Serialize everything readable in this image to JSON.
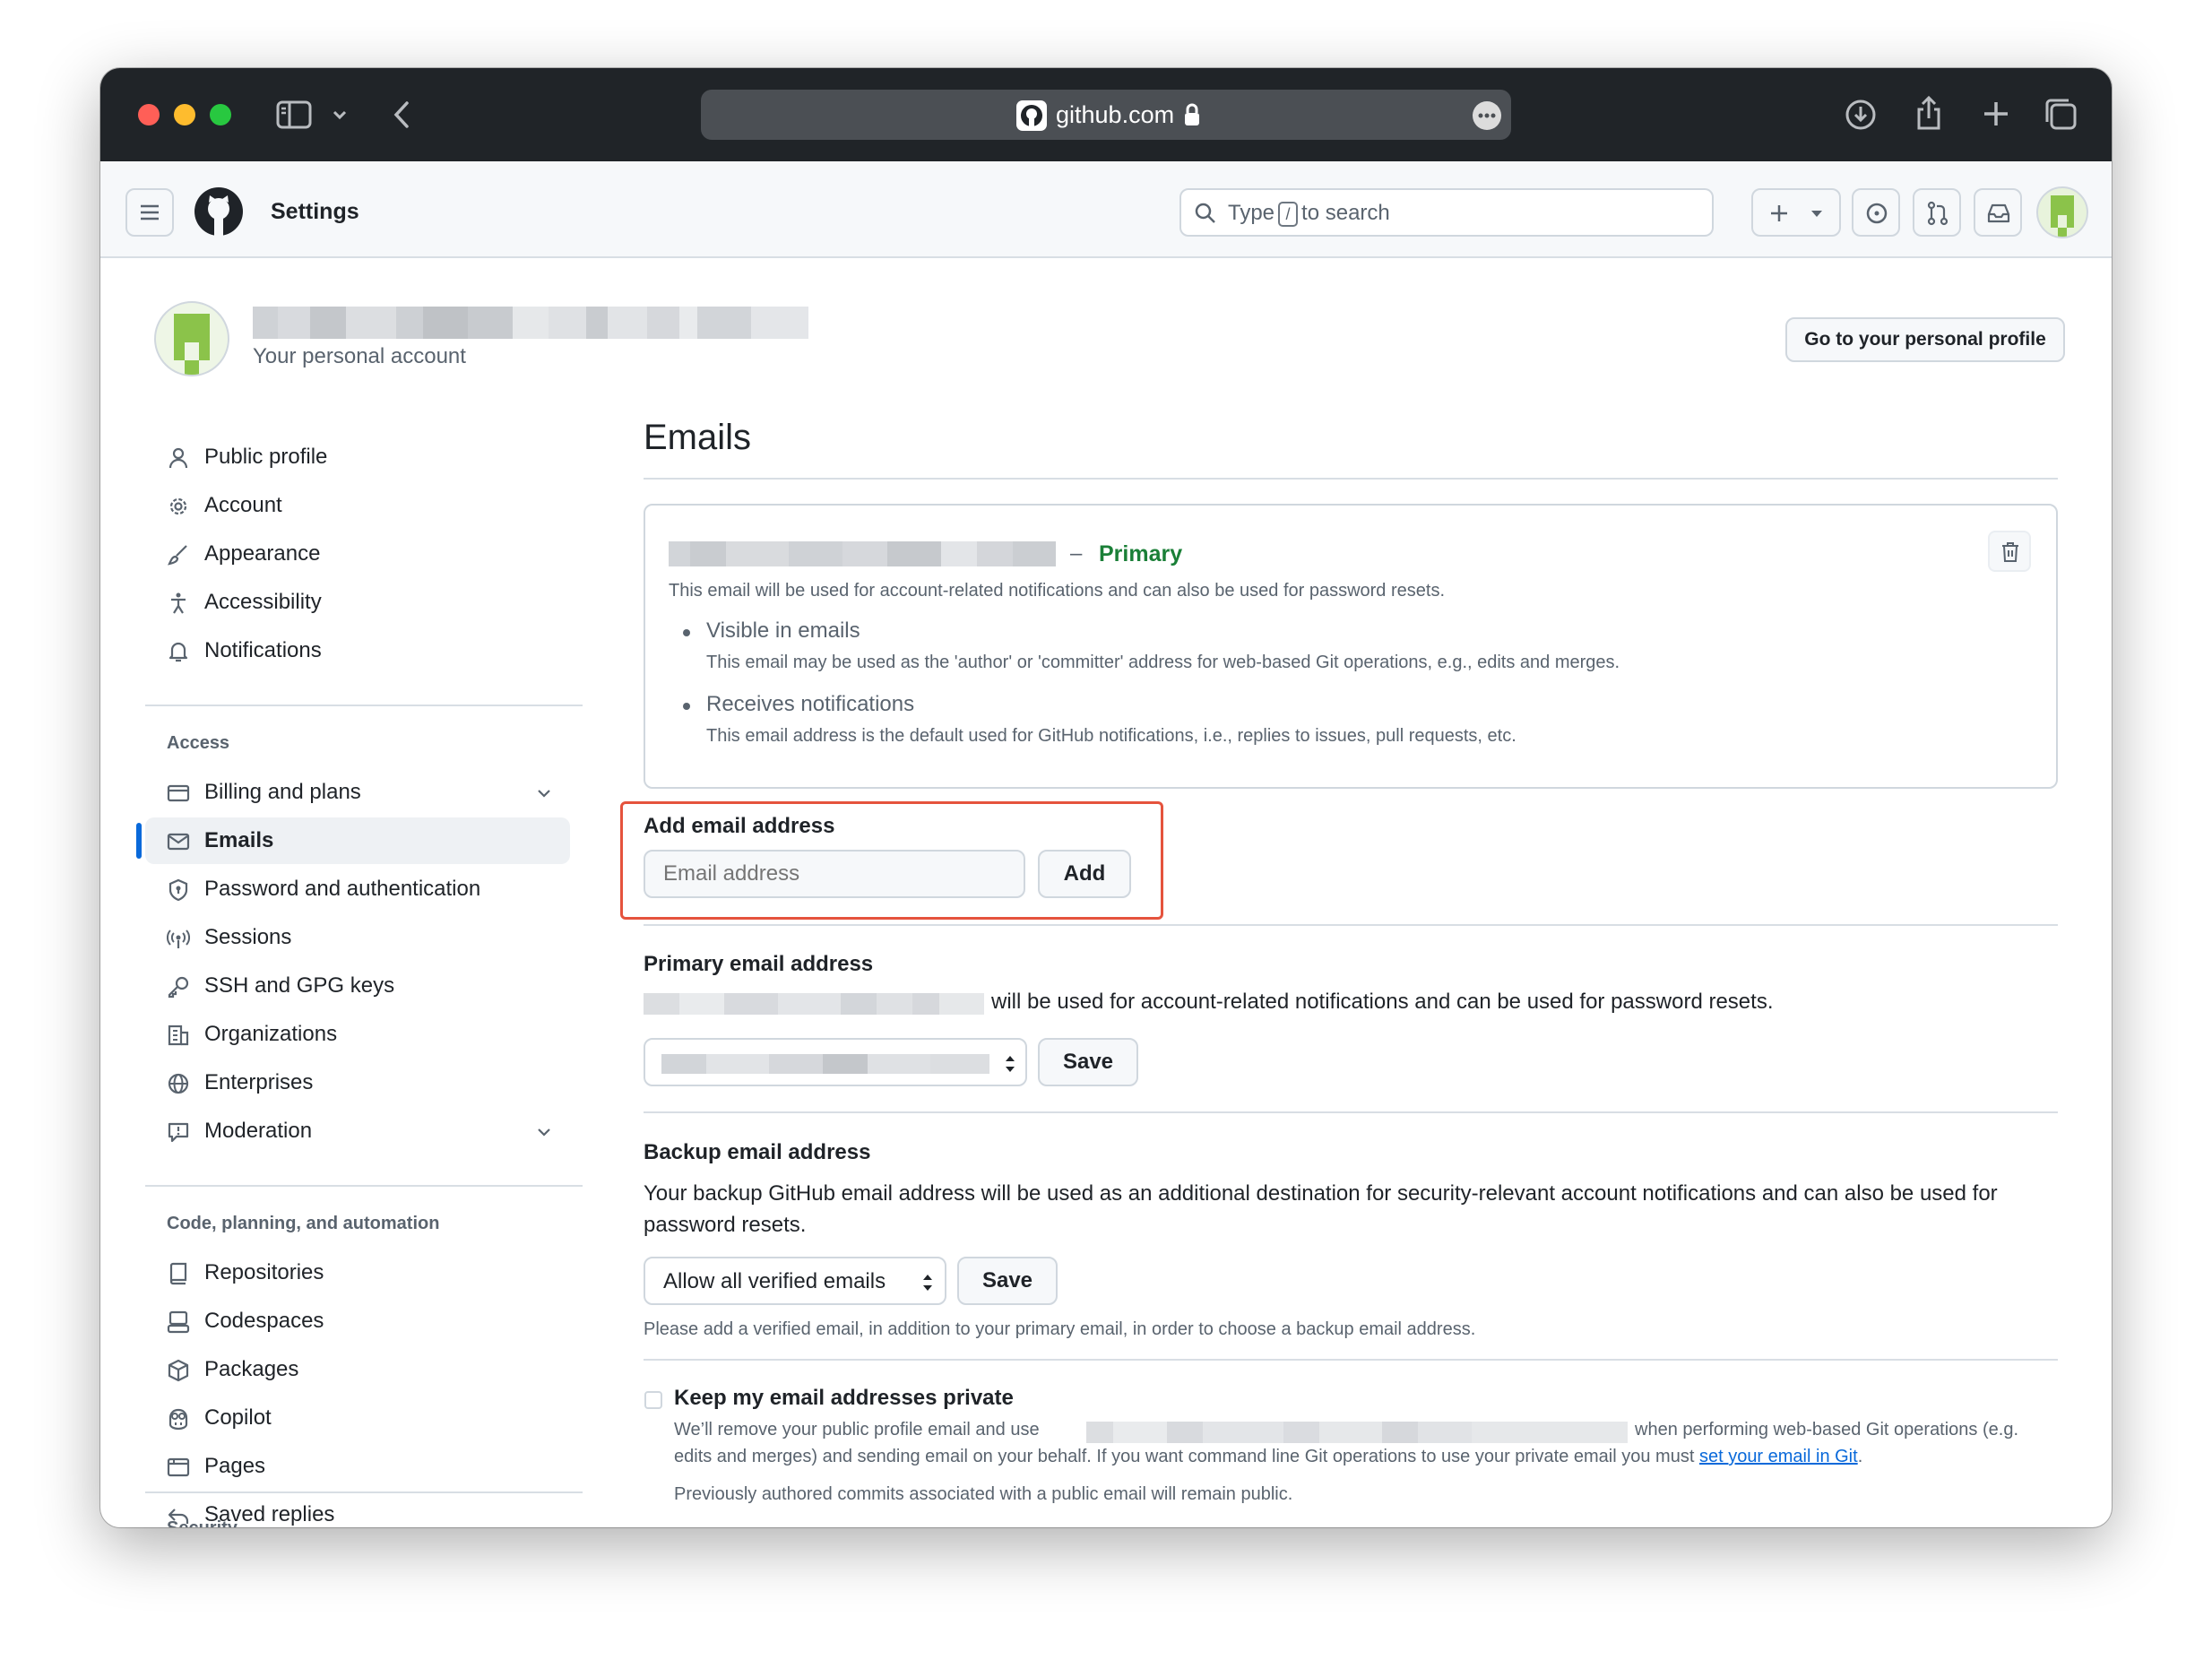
{
  "browser": {
    "url": "github.com",
    "traffic_lights": [
      "#ff5f57",
      "#febc2e",
      "#28c840"
    ]
  },
  "header": {
    "title": "Settings",
    "search_prefix": "Type",
    "search_key": "/",
    "search_suffix": "to search",
    "new_button": "+"
  },
  "account": {
    "subtitle": "Your personal account",
    "profile_button": "Go to your personal profile"
  },
  "sidebar": {
    "group1": [
      "Public profile",
      "Account",
      "Appearance",
      "Accessibility",
      "Notifications"
    ],
    "access_heading": "Access",
    "access": [
      "Billing and plans",
      "Emails",
      "Password and authentication",
      "Sessions",
      "SSH and GPG keys",
      "Organizations",
      "Enterprises",
      "Moderation"
    ],
    "code_heading": "Code, planning, and automation",
    "code": [
      "Repositories",
      "Codespaces",
      "Packages",
      "Copilot",
      "Pages",
      "Saved replies"
    ],
    "security_heading": "Security"
  },
  "main": {
    "page_title": "Emails",
    "primary_card": {
      "dash": "–",
      "badge": "Primary",
      "description": "This email will be used for account-related notifications and can also be used for password resets.",
      "bullets": [
        {
          "title": "Visible in emails",
          "text": "This email may be used as the 'author' or 'committer' address for web-based Git operations, e.g., edits and merges."
        },
        {
          "title": "Receives notifications",
          "text": "This email address is the default used for GitHub notifications, i.e., replies to issues, pull requests, etc."
        }
      ]
    },
    "add_email": {
      "label": "Add email address",
      "placeholder": "Email address",
      "button": "Add",
      "highlight_color": "#e5533d"
    },
    "primary_email": {
      "heading": "Primary email address",
      "text": "will be used for account-related notifications and can be used for password resets.",
      "button": "Save"
    },
    "backup_email": {
      "heading": "Backup email address",
      "text": "Your backup GitHub email address will be used as an additional destination for security-relevant account notifications and can also be used for password resets.",
      "selected": "Allow all verified emails",
      "button": "Save",
      "note": "Please add a verified email, in addition to your primary email, in order to choose a backup email address."
    },
    "private": {
      "label": "Keep my email addresses private",
      "checked": false,
      "text_before": "We’ll remove your public profile email and use",
      "text_after": "when performing web-based Git operations (e.g.",
      "text_line2": "edits and merges) and sending email on your behalf. If you want command line Git operations to use your private email you must",
      "link": "set your email in Git",
      "period": ".",
      "note": "Previously authored commits associated with a public email will remain public."
    }
  }
}
